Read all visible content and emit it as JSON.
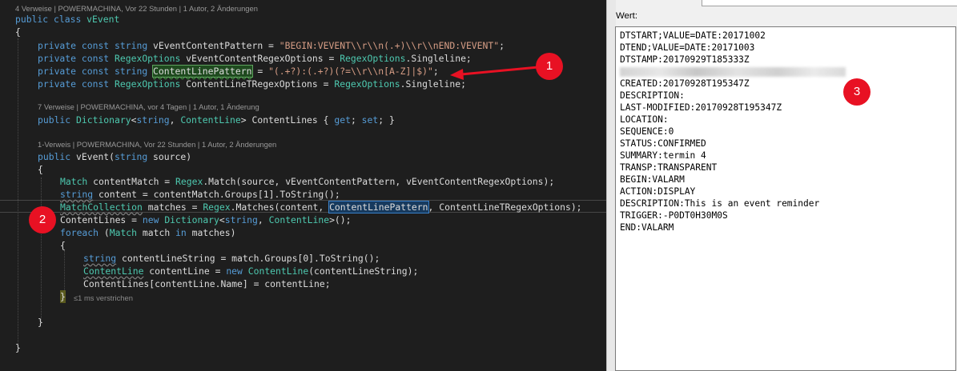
{
  "editor": {
    "codelens": {
      "class_refs": "4 Verweise | POWERMACHINA, Vor 22 Stunden | 1 Autor, 2 Änderungen",
      "property_refs": "7 Verweise | POWERMACHINA, vor 4 Tagen | 1 Autor, 1 Änderung",
      "ctor_refs": "1-Verweis | POWERMACHINA, Vor 22 Stunden | 1 Autor, 2 Änderungen"
    },
    "elapsed_hint": "≤1 ms verstrichen",
    "code": {
      "l1": [
        "public",
        " ",
        "class",
        " ",
        "vEvent"
      ],
      "l2": "{",
      "l3": [
        "private",
        " ",
        "const",
        " ",
        "string",
        " vEventContentPattern = ",
        "\"BEGIN:VEVENT\\\\r\\\\n(.+)\\\\r\\\\nEND:VEVENT\"",
        ";"
      ],
      "l4": [
        "private",
        " ",
        "const",
        " ",
        "RegexOptions",
        " vEventContentRegexOptions = ",
        "RegexOptions",
        ".Singleline;"
      ],
      "l5": [
        "private",
        " ",
        "const",
        " ",
        "string",
        " ",
        "ContentLinePattern",
        " = ",
        "\"(.+?):(.+?)(?=\\\\r\\\\n[A-Z]|$)\"",
        ";"
      ],
      "l6": [
        "private",
        " ",
        "const",
        " ",
        "RegexOptions",
        " ContentLineTRegexOptions = ",
        "RegexOptions",
        ".Singleline;"
      ],
      "l7": [
        "public",
        " ",
        "Dictionary",
        "<",
        "string",
        ", ",
        "ContentLine",
        "> ContentLines { ",
        "get",
        "; ",
        "set",
        "; }"
      ],
      "l8": [
        "public",
        " vEvent(",
        "string",
        " source)"
      ],
      "l9": "{",
      "l10": [
        "Match",
        " contentMatch = ",
        "Regex",
        ".Match(source, vEventContentPattern, vEventContentRegexOptions);"
      ],
      "l11": [
        "string",
        " content = contentMatch.Groups[1].ToString();"
      ],
      "l12": [
        "MatchCollection",
        " matches = ",
        "Regex",
        ".Matches(content, ",
        "ContentLinePattern",
        ", ContentLineTRegexOptions);"
      ],
      "l13": [
        "ContentLines = ",
        "new",
        " ",
        "Dictionary",
        "<",
        "string",
        ", ",
        "ContentLine",
        ">();"
      ],
      "l14": [
        "foreach",
        " (",
        "Match",
        " match ",
        "in",
        " matches)"
      ],
      "l15": "{",
      "l16": [
        "string",
        " contentLineString = match.Groups[0].ToString();"
      ],
      "l17": [
        "ContentLine",
        " contentLine = ",
        "new",
        " ",
        "ContentLine",
        "(contentLineString);"
      ],
      "l18": "ContentLines[contentLine.Name] = contentLine;",
      "l19": "}",
      "l20": "}",
      "l21": "}"
    }
  },
  "markers": [
    "1",
    "2",
    "3"
  ],
  "panel": {
    "label": "Wert:",
    "lines": [
      "DTSTART;VALUE=DATE:20171002",
      "DTEND;VALUE=DATE:20171003",
      "DTSTAMP:20170929T185333Z",
      "",
      "CREATED:20170928T195347Z",
      "DESCRIPTION:",
      "LAST-MODIFIED:20170928T195347Z",
      "LOCATION:",
      "SEQUENCE:0",
      "STATUS:CONFIRMED",
      "SUMMARY:termin 4",
      "TRANSP:TRANSPARENT",
      "BEGIN:VALARM",
      "ACTION:DISPLAY",
      "DESCRIPTION:This is an event reminder",
      "TRIGGER:-P0DT0H30M0S",
      "END:VALARM"
    ]
  },
  "colors": {
    "editor_bg": "#1e1e1e",
    "keyword": "#569cd6",
    "type": "#4ec9b0",
    "string": "#d69d85",
    "marker": "#e81123",
    "arrow": "#e81123"
  }
}
